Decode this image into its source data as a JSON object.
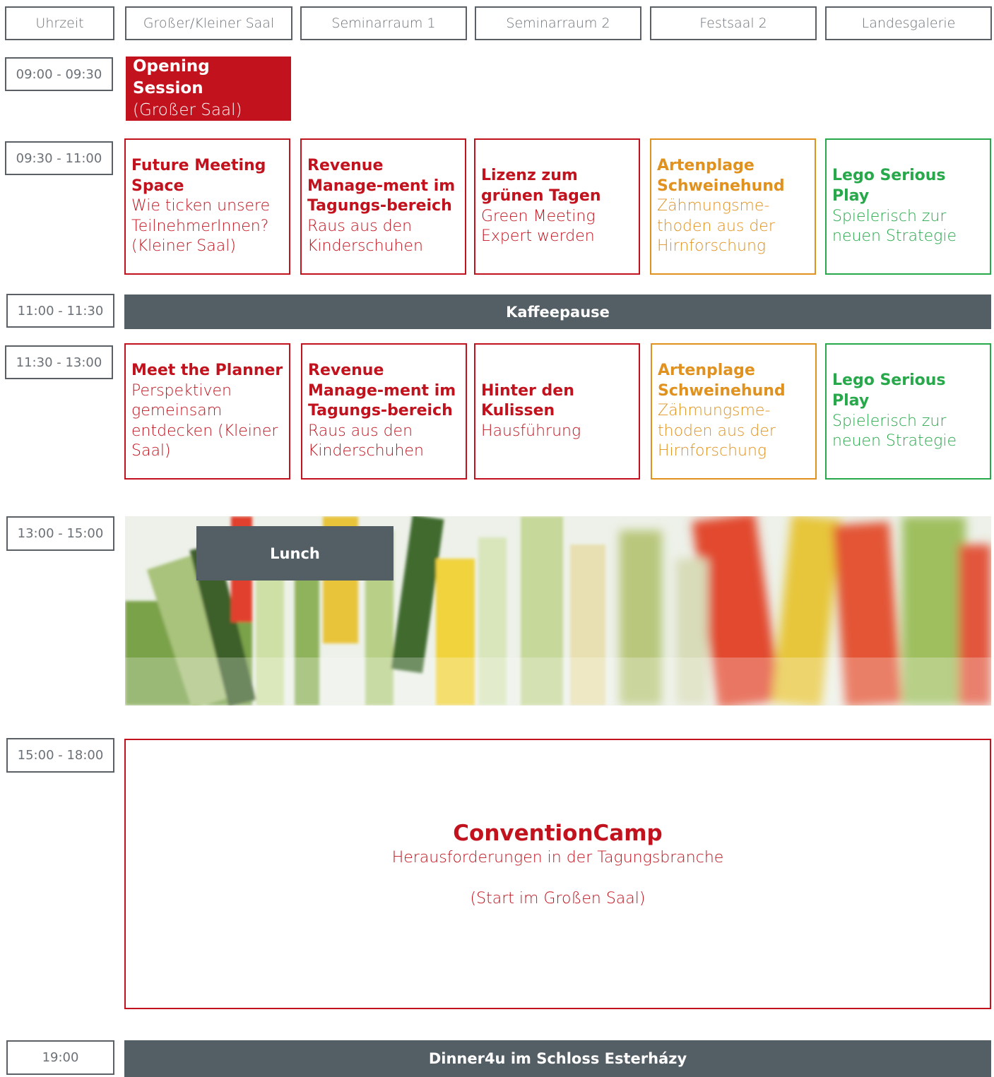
{
  "headers": [
    "Uhrzeit",
    "Großer/Kleiner Saal",
    "Seminarraum 1",
    "Seminarraum 2",
    "Festsaal 2",
    "Landesgalerie"
  ],
  "times": [
    "09:00 - 09:30",
    "09:30 - 11:00",
    "11:00 - 11:30",
    "11:30 - 13:00",
    "13:00 - 15:00",
    "15:00 - 18:00",
    "19:00"
  ],
  "opening": {
    "title": "Opening Session",
    "sub": "(Großer Saal)"
  },
  "block1": [
    {
      "title": "Future Meeting Space",
      "sub": "Wie ticken unsere TeilnehmerInnen? (Kleiner Saal)"
    },
    {
      "title": "Revenue Manage-ment im Tagungs-bereich",
      "sub": "Raus aus den Kinderschuhen"
    },
    {
      "title": "Lizenz zum grünen Tagen",
      "sub": "Green Meeting Expert werden"
    },
    {
      "title": "Artenplage Schweinehund",
      "sub": "Zähmungsme-thoden aus der Hirnforschung"
    },
    {
      "title": "Lego Serious Play",
      "sub": "Spielerisch zur neuen Strategie"
    }
  ],
  "coffee": "Kaffeepause",
  "block2": [
    {
      "title": "Meet the Planner",
      "sub": "Perspektiven gemeinsam entdecken (Kleiner Saal)"
    },
    {
      "title": "Revenue Manage-ment im Tagungs-bereich",
      "sub": "Raus aus den Kinderschuhen"
    },
    {
      "title": "Hinter den Kulissen",
      "sub": "Hausführung"
    },
    {
      "title": "Artenplage Schweinehund",
      "sub": "Zähmungsme-thoden aus der Hirnforschung"
    },
    {
      "title": "Lego Serious Play",
      "sub": "Spielerisch zur neuen Strategie"
    }
  ],
  "lunch": "Lunch",
  "camp": {
    "title": "ConventionCamp",
    "sub": "Herausforderungen in der Tagungsbranche",
    "note": "(Start im Großen Saal)"
  },
  "dinner": "Dinner4u im Schloss Esterházy",
  "colors": {
    "red": "#c1121d",
    "orange": "#e0911e",
    "green": "#27a84a",
    "slate": "#545e65"
  }
}
